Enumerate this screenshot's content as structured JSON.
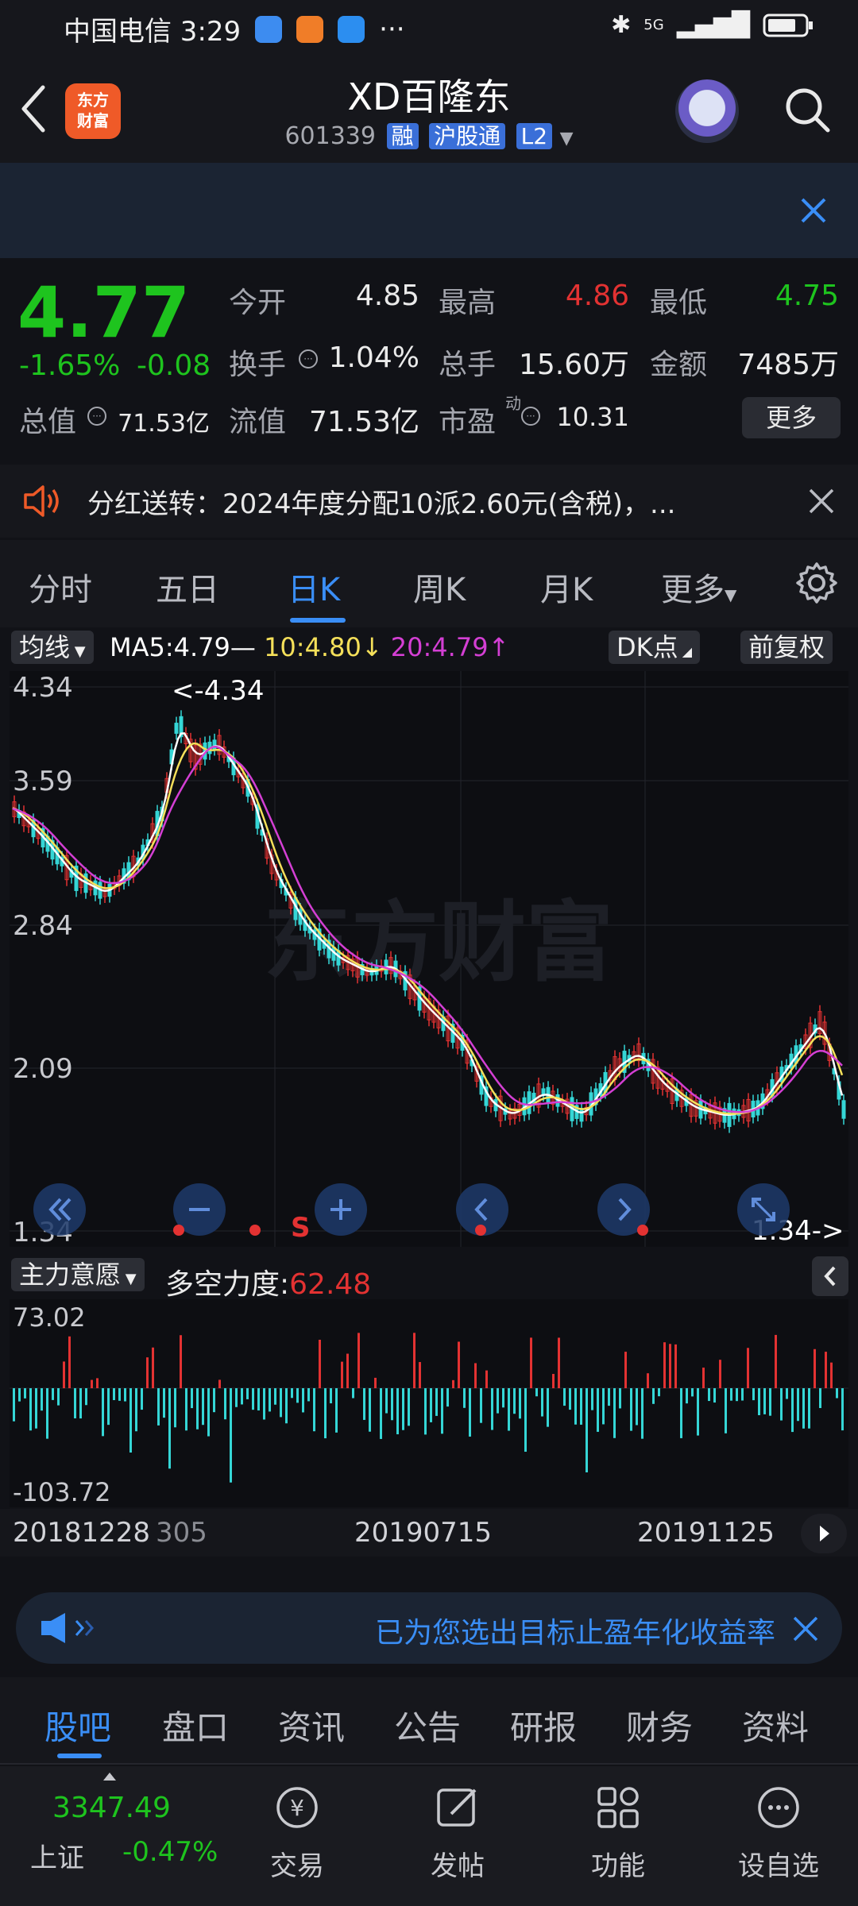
{
  "status_bar": {
    "time": "中国电信 3:29",
    "more": "···",
    "network": "5G"
  },
  "header": {
    "logo_text": "东方\n财富",
    "title": "XD百隆东",
    "code": "601339",
    "tags": [
      "融",
      "沪股通",
      "L2"
    ]
  },
  "quote": {
    "price": "4.77",
    "change_pct": "-1.65%",
    "change": "-0.08",
    "open_label": "今开",
    "open": "4.85",
    "high_label": "最高",
    "high": "4.86",
    "low_label": "最低",
    "low": "4.75",
    "turnover_label": "换手",
    "turnover": "1.04%",
    "volume_label": "总手",
    "volume": "15.60万",
    "amount_label": "金额",
    "amount": "7485万",
    "total_mv_label": "总值",
    "total_mv": "71.53亿",
    "float_mv_label": "流值",
    "float_mv": "71.53亿",
    "pe_label": "市盈",
    "pe_sup": "动",
    "pe": "10.31",
    "more_button": "更多"
  },
  "notice": {
    "text": "分红送转：2024年度分配10派2.60元(含税)，..."
  },
  "period_tabs": [
    "分时",
    "五日",
    "日K",
    "周K",
    "月K",
    "更多"
  ],
  "ma_bar": {
    "selector": "均线",
    "ma5": "MA5:4.79—",
    "ma10": "10:4.80↓",
    "ma20": "20:4.79↑",
    "dk_button": "DK点",
    "adjust_button": "前复权"
  },
  "kchart": {
    "y_labels": [
      "4.34",
      "3.59",
      "2.84",
      "2.09",
      "1.34"
    ],
    "max_note": "<-4.34",
    "min_note": "1.34->",
    "watermark": "东方财富",
    "signal": "S"
  },
  "indicator": {
    "selector": "主力意愿",
    "label": "多空力度:",
    "value": "62.48",
    "top": "73.02",
    "bottom": "-103.72"
  },
  "dates": [
    "20181228",
    "305",
    "20190715",
    "20191125"
  ],
  "promo": {
    "text": "已为您选出目标止盈年化收益率"
  },
  "bottom_tabs": [
    "股吧",
    "盘口",
    "资讯",
    "公告",
    "研报",
    "财务",
    "资料"
  ],
  "nav": {
    "index_value": "3347.49",
    "index_name": "上证",
    "index_change": "-0.47%",
    "items": [
      "交易",
      "发帖",
      "功能",
      "设自选"
    ]
  },
  "colors": {
    "up": "#e33232",
    "down": "#1ec41e",
    "accent": "#3a8ef6",
    "ma5": "#ffffff",
    "ma10": "#f5e05a",
    "ma20": "#d43fd4",
    "bar_up": "#e33232",
    "bar_down": "#35d6d6"
  }
}
